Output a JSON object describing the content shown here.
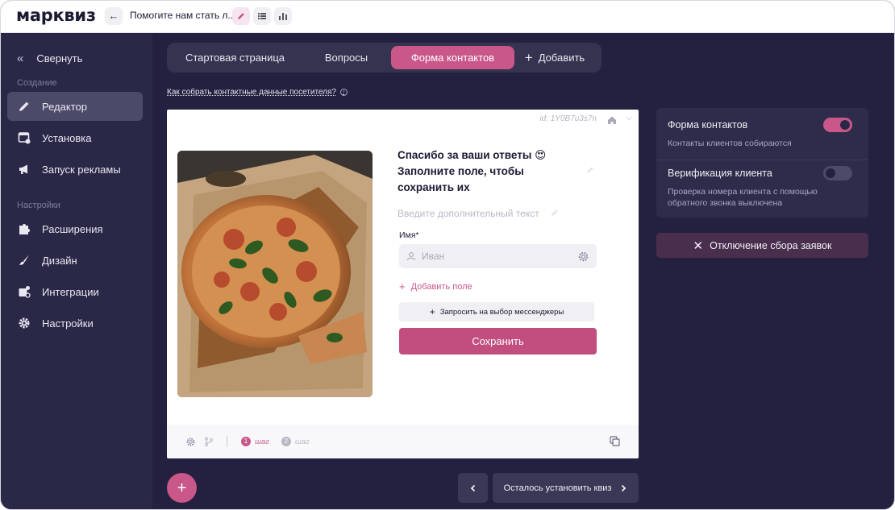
{
  "app": {
    "logo": "марквиз"
  },
  "topbar": {
    "title": "Помогите нам стать л..."
  },
  "sidebar": {
    "collapse_label": "Свернуть",
    "section_creation": "Создание",
    "section_settings": "Настройки",
    "items": [
      {
        "label": "Редактор",
        "icon": "pencil-icon",
        "active": true
      },
      {
        "label": "Установка",
        "icon": "install-icon"
      },
      {
        "label": "Запуск рекламы",
        "icon": "megaphone-icon"
      },
      {
        "label": "Расширения",
        "icon": "puzzle-icon"
      },
      {
        "label": "Дизайн",
        "icon": "brush-icon"
      },
      {
        "label": "Интеграции",
        "icon": "integrations-icon"
      },
      {
        "label": "Настройки",
        "icon": "gear-icon"
      }
    ]
  },
  "tabs": [
    {
      "label": "Стартовая страница"
    },
    {
      "label": "Вопросы"
    },
    {
      "label": "Форма контактов",
      "active": true
    },
    {
      "label": "Добавить"
    }
  ],
  "help_link": "Как собрать контактные данные посетителя?",
  "canvas": {
    "id_label": "id: 1Y0B7u3s7n",
    "form_title": "Спасибо за ваши ответы 😍 Заполните поле, чтобы сохранить их",
    "form_subtitle": "Введите дополнительный текст",
    "field_label": "Имя*",
    "field_placeholder": "Иван",
    "add_field": "Добавить поле",
    "messengers_button": "Запросить на выбор мессенджеры",
    "save_button": "Сохранить",
    "steps": [
      {
        "num": "1",
        "label": "шаг"
      },
      {
        "num": "2",
        "label": "шаг"
      }
    ]
  },
  "right_panel": {
    "contact_form_title": "Форма контактов",
    "contact_form_sub": "Контакты клиентов собираются",
    "contact_form_enabled": true,
    "verify_title": "Верификация клиента",
    "verify_sub": "Проверка номера клиента с помощью обратного звонка выключена",
    "verify_enabled": false,
    "disable_button": "Отключение сбора заявок"
  },
  "bottom": {
    "next_label": "Осталось установить квиз"
  },
  "colors": {
    "accent": "#c9578a",
    "sidebar_bg": "#2a2847",
    "main_bg": "#23213f"
  }
}
